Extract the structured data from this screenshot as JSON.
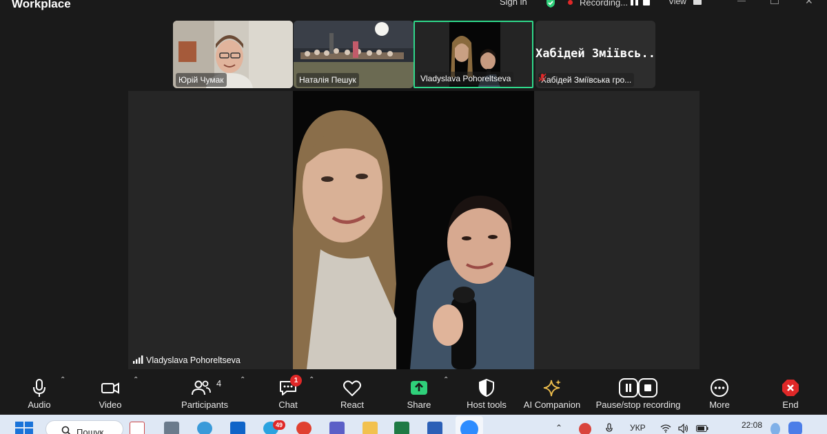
{
  "window": {
    "title": "Workplace",
    "sign_in": "Sign in",
    "recording": "Recording...",
    "view": "View"
  },
  "thumbnails": [
    {
      "name": "Юрій Чумак"
    },
    {
      "name": "Наталія Пешук"
    },
    {
      "name": "Vladyslava Pohoreltseva"
    },
    {
      "name_big": "Хабідей Зміївсь...",
      "name": "Хабідей Зміївська гро..."
    }
  ],
  "speaker": {
    "name": "Vladyslava Pohoreltseva"
  },
  "toolbar": {
    "audio": "Audio",
    "video": "Video",
    "participants": "Participants",
    "participants_count": "4",
    "chat": "Chat",
    "chat_badge": "1",
    "react": "React",
    "share": "Share",
    "host_tools": "Host tools",
    "ai_companion": "AI Companion",
    "pause_stop": "Pause/stop recording",
    "more": "More",
    "end": "End"
  },
  "taskbar": {
    "search_placeholder": "Пошук",
    "telegram_badge": "49",
    "language": "УКР",
    "time": "22:08"
  },
  "colors": {
    "active_border": "#2fd98b",
    "share_green": "#2fd07a",
    "end_red": "#e02828"
  }
}
